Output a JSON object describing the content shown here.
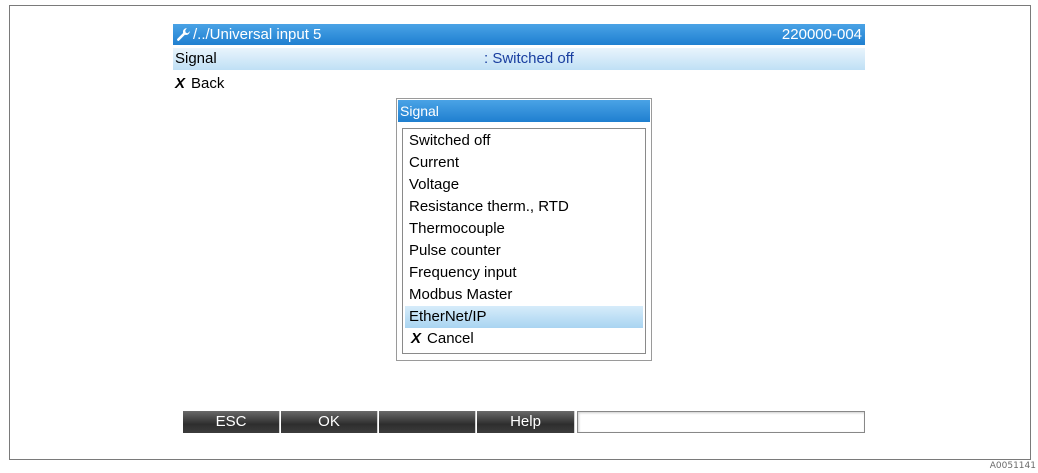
{
  "header": {
    "icon": "wrench-icon",
    "path": "/../Universal input 5",
    "code": "220000-004"
  },
  "signal_row": {
    "label": "Signal",
    "value": ": Switched off"
  },
  "back": {
    "icon": "x-icon",
    "label": "Back"
  },
  "popup": {
    "title": "Signal",
    "options": [
      "Switched off",
      "Current",
      "Voltage",
      "Resistance therm., RTD",
      "Thermocouple",
      "Pulse counter",
      "Frequency input",
      "Modbus Master",
      "EtherNet/IP"
    ],
    "selected": "EtherNet/IP",
    "cancel_icon": "x-icon",
    "cancel_label": "Cancel"
  },
  "softkeys": [
    "ESC",
    "OK",
    "",
    "Help"
  ],
  "figure_id": "A0051141",
  "colors": {
    "title_bar": "#1f7fd0",
    "row_highlight": "#bfe0f5",
    "softkey": "#2e2e2e",
    "value_text": "#1a3fa0"
  }
}
